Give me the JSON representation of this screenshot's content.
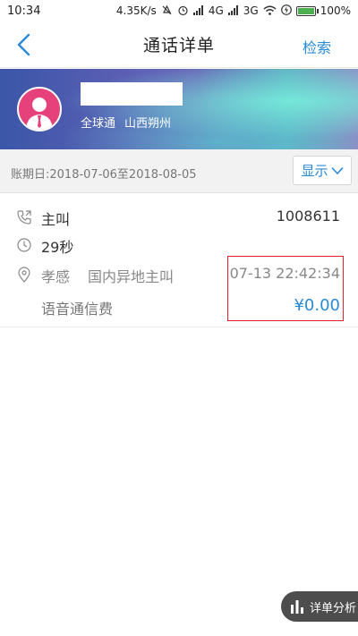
{
  "status_bar": {
    "time": "10:34",
    "net_speed": "4.35K/s",
    "network_4g": "4G",
    "network_3g": "3G",
    "battery_pct": "100%"
  },
  "nav": {
    "title": "通话详单",
    "search_label": "检索"
  },
  "profile": {
    "plan": "全球通",
    "region": "山西朔州"
  },
  "period": {
    "text": "账期日:2018-07-06至2018-08-05",
    "display_label": "显示"
  },
  "record": {
    "call_type": "主叫",
    "number": "1008611",
    "duration": "29秒",
    "location": "孝感",
    "roam_type": "国内异地主叫",
    "datetime": "07-13 22:42:34",
    "fee_label": "语音通信费",
    "fee": "¥0.00"
  },
  "analysis_button": {
    "label": "详单分析"
  },
  "colors": {
    "accent": "#2a8ad6",
    "highlight": "#e0232a",
    "avatar": "#e6417a"
  }
}
